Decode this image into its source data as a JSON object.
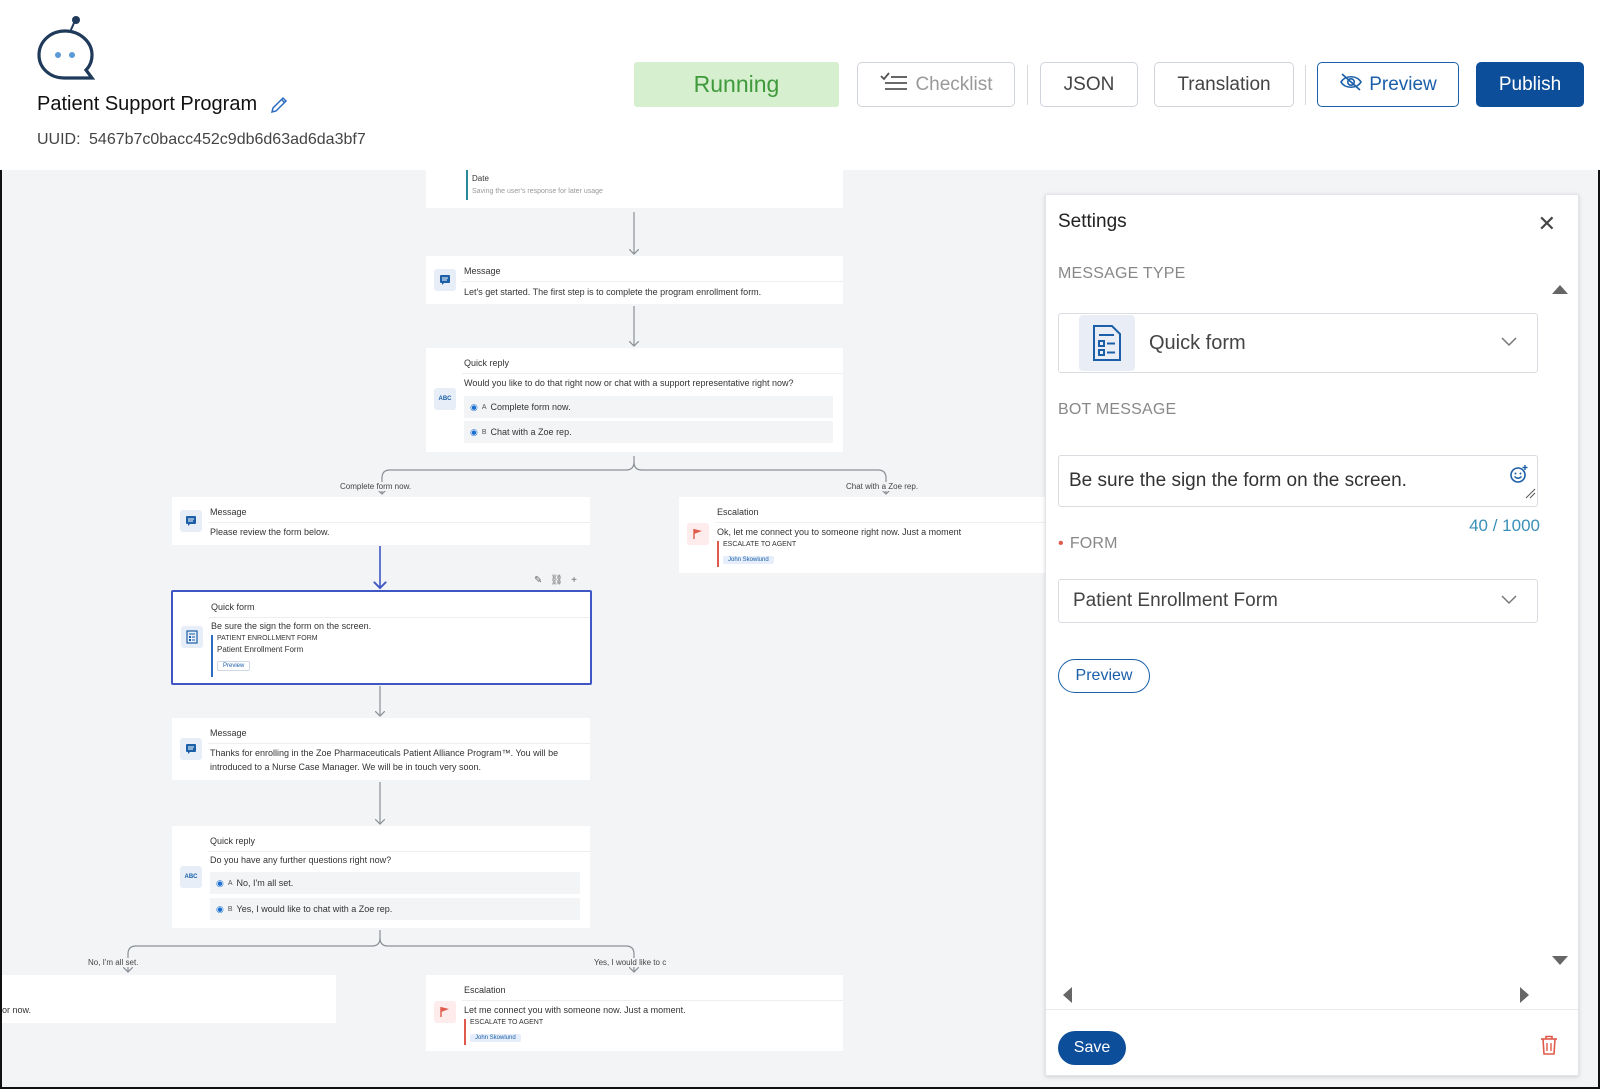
{
  "header": {
    "app_title": "Patient Support Program",
    "uuid_label": "UUID:",
    "uuid_value": "5467b7c0bacc452c9db6d63ad6da3bf7",
    "status": "Running",
    "status_color": "#3f9a3b",
    "buttons": {
      "checklist": "Checklist",
      "json": "JSON",
      "translation": "Translation",
      "preview": "Preview",
      "publish": "Publish"
    },
    "accent_color": "#0d4e9a"
  },
  "flow": {
    "top_node": {
      "field": "Date",
      "desc": "Saving the user's response for later usage"
    },
    "msg1": {
      "type": "Message",
      "text": "Let's get started. The first step is to complete the program enrollment form."
    },
    "qr1": {
      "type": "Quick reply",
      "text": "Would you like to do that right now or chat with a support representative right now?",
      "options": [
        {
          "letter": "A",
          "label": "Complete form now."
        },
        {
          "letter": "B",
          "label": "Chat with a Zoe rep."
        }
      ]
    },
    "edge_labels": {
      "left": "Complete form now.",
      "right": "Chat with a Zoe rep.",
      "left2": "No, I'm all set.",
      "right2": "Yes, I would like to c"
    },
    "msg2": {
      "type": "Message",
      "text": "Please review the form below."
    },
    "esc1": {
      "type": "Escalation",
      "text": "Ok, let me connect you to someone right now. Just a moment",
      "field": "ESCALATE TO AGENT",
      "agent": "John Skowlund"
    },
    "qf": {
      "type": "Quick form",
      "text": "Be sure the sign the form on the screen.",
      "field": "PATIENT ENROLLMENT FORM",
      "form_name": "Patient Enrollment Form",
      "chip": "Preview"
    },
    "msg3": {
      "type": "Message",
      "line1": "Thanks for enrolling in the Zoe Pharmaceuticals Patient Alliance Program™. You will be",
      "line2": "introduced to a Nurse Case Manager. We will be in touch very soon."
    },
    "qr2": {
      "type": "Quick reply",
      "text": "Do you have any further questions right now?",
      "options": [
        {
          "letter": "A",
          "label": "No, I'm all set."
        },
        {
          "letter": "B",
          "label": "Yes, I would like to chat with a Zoe rep."
        }
      ]
    },
    "partial_node": {
      "text": "or now."
    },
    "esc2": {
      "type": "Escalation",
      "text": "Let me connect you with someone now. Just a moment.",
      "field": "ESCALATE TO AGENT",
      "agent": "John Skowlund"
    }
  },
  "settings": {
    "title": "Settings",
    "message_type_label": "MESSAGE TYPE",
    "message_type_value": "Quick form",
    "bot_message_label": "BOT MESSAGE",
    "bot_message_value": "Be sure the sign the form on the screen.",
    "counter": "40 / 1000",
    "form_label": "FORM",
    "form_value": "Patient Enrollment Form",
    "preview_button": "Preview",
    "save_button": "Save"
  }
}
